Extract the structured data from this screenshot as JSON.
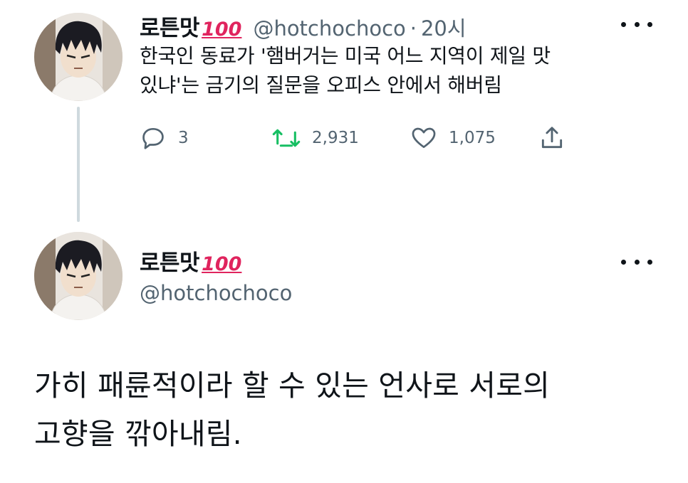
{
  "first_tweet": {
    "display_name": "로튼맛",
    "badge": "100",
    "handle": "@hotchochoco",
    "separator": "·",
    "time": "20시",
    "text_line1": "한국인 동료가 '햄버거는 미국 어느 지역이 제일 맛",
    "text_line2": "있냐'는 금기의 질문을 오피스 안에서 해버림",
    "reply_count": "3",
    "retweet_count": "2,931",
    "like_count": "1,075",
    "icons": [
      "reply-icon",
      "retweet-icon",
      "like-icon",
      "share-icon",
      "more-icon"
    ],
    "retweet_color": "#17bf63"
  },
  "second_tweet": {
    "display_name": "로튼맛",
    "badge": "100",
    "handle": "@hotchochoco",
    "text_line1": "가히 패륜적이라 할 수 있는 언사로 서로의",
    "text_line2": "고향을 깎아내림."
  }
}
